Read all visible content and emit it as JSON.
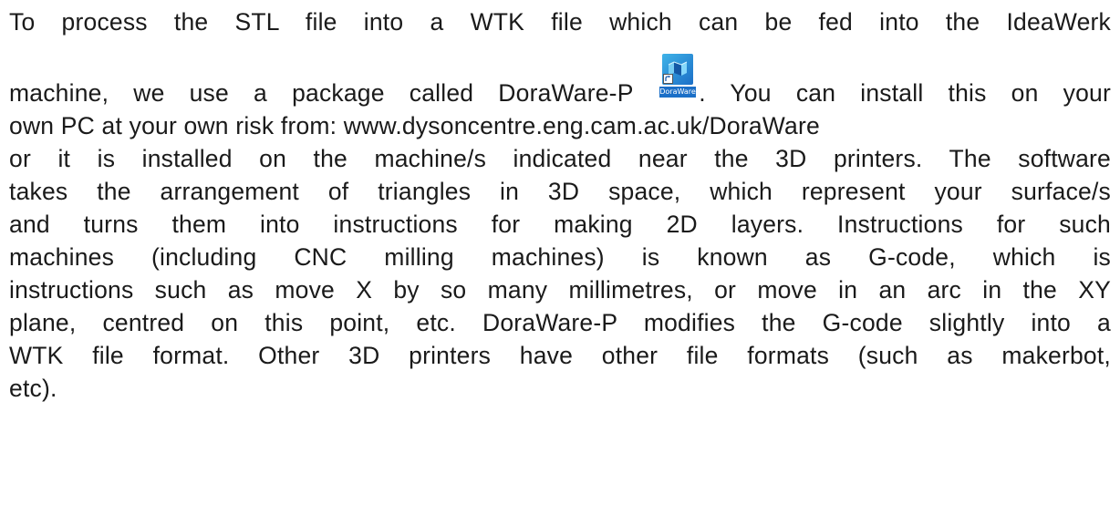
{
  "document": {
    "line1": "To process the STL file into a WTK file which can be fed into the IdeaWerk",
    "line2_before_icon": "machine, we use a package called DoraWare-P",
    "line2_after_icon": ". You can install this on your",
    "line3": "own PC at your own risk from: www.dysoncentre.eng.cam.ac.uk/DoraWare",
    "line4": "or it is installed on the machine/s indicated near the 3D printers. The software",
    "line5": "takes the arrangement of triangles in 3D space, which represent your surface/s",
    "line6": "and turns them into instructions for making 2D layers. Instructions for such",
    "line7": "machines (including CNC milling machines) is known as G-code, which is",
    "line8": "instructions such as move X by so many millimetres, or move in an arc in the XY",
    "line9": "plane, centred on this point, etc. DoraWare-P modifies the G-code slightly into a",
    "line10": "WTK file format. Other 3D printers have other file formats (such as makerbot,",
    "line11": "etc)."
  },
  "app_icon": {
    "label": "DoraWare-P",
    "icon_name": "doraware-p-app-icon",
    "colors": {
      "tile_light": "#3fb3e8",
      "tile_dark": "#1b6fc7"
    }
  }
}
